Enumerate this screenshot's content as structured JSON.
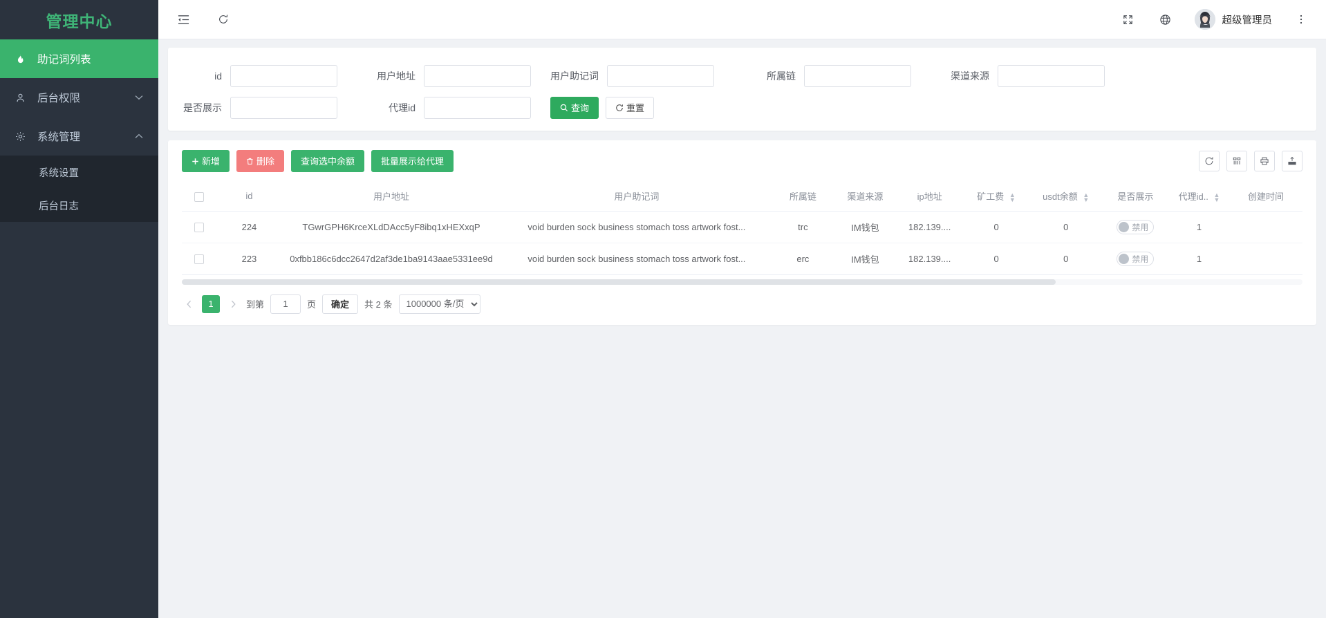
{
  "sidebar": {
    "brand": "管理中心",
    "items": [
      {
        "label": "助记词列表",
        "icon": "fire-icon",
        "active": true,
        "expandable": false
      },
      {
        "label": "后台权限",
        "icon": "user-icon",
        "active": false,
        "expandable": true,
        "expanded": false
      },
      {
        "label": "系统管理",
        "icon": "gear-icon",
        "active": false,
        "expandable": true,
        "expanded": true
      }
    ],
    "submenu": [
      {
        "label": "系统设置"
      },
      {
        "label": "后台日志"
      }
    ]
  },
  "topbar": {
    "collapse_icon": "menu-collapse-icon",
    "refresh_icon": "refresh-icon",
    "fullscreen_icon": "fullscreen-icon",
    "language_icon": "globe-icon",
    "user_name": "超级管理员",
    "more_icon": "more-vertical-icon"
  },
  "search": {
    "fields": [
      {
        "label": "id",
        "value": "",
        "placeholder": ""
      },
      {
        "label": "用户地址",
        "value": "",
        "placeholder": ""
      },
      {
        "label": "用户助记词",
        "value": "",
        "placeholder": ""
      },
      {
        "label": "所属链",
        "value": "",
        "placeholder": ""
      },
      {
        "label": "渠道来源",
        "value": "",
        "placeholder": ""
      },
      {
        "label": "是否展示",
        "value": "",
        "placeholder": ""
      },
      {
        "label": "代理id",
        "value": "",
        "placeholder": ""
      }
    ],
    "query_button": "查询",
    "reset_button": "重置"
  },
  "toolbar": {
    "add_label": "新增",
    "delete_label": "删除",
    "query_balance_label": "查询选中余额",
    "batch_show_agent_label": "批量展示给代理",
    "tools": [
      {
        "name": "refresh-icon"
      },
      {
        "name": "columns-icon"
      },
      {
        "name": "print-icon"
      },
      {
        "name": "export-icon"
      }
    ]
  },
  "table": {
    "columns": [
      {
        "key": "checkbox",
        "label": "",
        "sortable": false
      },
      {
        "key": "id",
        "label": "id",
        "sortable": false
      },
      {
        "key": "address",
        "label": "用户地址",
        "sortable": false
      },
      {
        "key": "mnemonic",
        "label": "用户助记词",
        "sortable": false
      },
      {
        "key": "chain",
        "label": "所属链",
        "sortable": false
      },
      {
        "key": "channel",
        "label": "渠道来源",
        "sortable": false
      },
      {
        "key": "ip",
        "label": "ip地址",
        "sortable": false
      },
      {
        "key": "gas",
        "label": "矿工费",
        "sortable": true
      },
      {
        "key": "usdt",
        "label": "usdt余额",
        "sortable": true
      },
      {
        "key": "show",
        "label": "是否展示",
        "sortable": false
      },
      {
        "key": "agent",
        "label": "代理id..",
        "sortable": true
      },
      {
        "key": "created",
        "label": "创建时间",
        "sortable": false
      }
    ],
    "rows": [
      {
        "id": "224",
        "address": "TGwrGPH6KrceXLdDAcc5yF8ibq1xHEXxqP",
        "mnemonic": "void burden sock business stomach toss artwork fost...",
        "chain": "trc",
        "channel": "IM钱包",
        "ip": "182.139....",
        "gas": "0",
        "usdt": "0",
        "show": "禁用",
        "agent": "1",
        "created": ""
      },
      {
        "id": "223",
        "address": "0xfbb186c6dcc2647d2af3de1ba9143aae5331ee9d",
        "mnemonic": "void burden sock business stomach toss artwork fost...",
        "chain": "erc",
        "channel": "IM钱包",
        "ip": "182.139....",
        "gas": "0",
        "usdt": "0",
        "show": "禁用",
        "agent": "1",
        "created": ""
      }
    ]
  },
  "pagination": {
    "prev_icon": "chevron-left-icon",
    "next_icon": "chevron-right-icon",
    "current_page": "1",
    "goto_prefix": "到第",
    "goto_value": "1",
    "goto_suffix": "页",
    "confirm_label": "确定",
    "total_text": "共 2 条",
    "page_size": "1000000 条/页",
    "page_size_options": [
      "1000000 条/页"
    ]
  },
  "colors": {
    "brand_green": "#3fb477",
    "sidebar_bg": "#2b333e",
    "submenu_bg": "#20262e",
    "primary": "#3ab36d",
    "danger": "#f37d7d",
    "link": "#2a3fd8"
  }
}
